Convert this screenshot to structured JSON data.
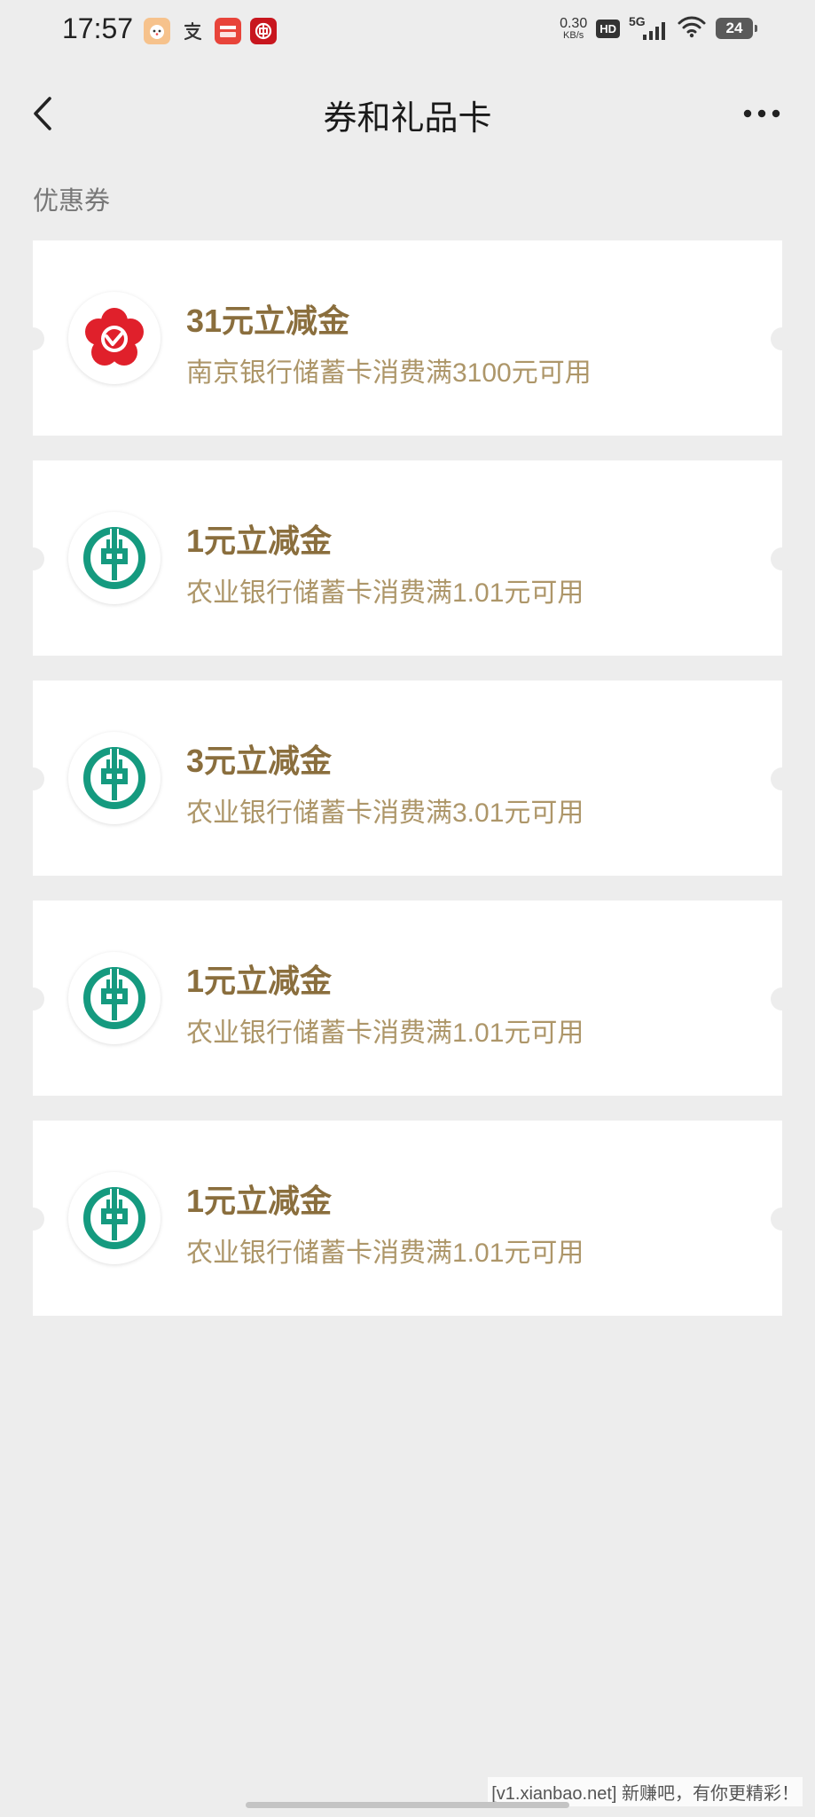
{
  "status_bar": {
    "time": "17:57",
    "net_speed_value": "0.30",
    "net_speed_unit": "KB/s",
    "hd_label": "HD",
    "network_label": "5G",
    "battery": "24",
    "app_icons": [
      "pet-app-icon",
      "alipay-app-icon",
      "unionpay-app-icon",
      "bank-of-china-app-icon"
    ]
  },
  "nav": {
    "title": "券和礼品卡"
  },
  "section": {
    "title": "优惠券"
  },
  "coupons": [
    {
      "bank": "nanjing-bank",
      "title": "31元立减金",
      "desc": "南京银行储蓄卡消费满3100元可用"
    },
    {
      "bank": "agricultural-bank",
      "title": "1元立减金",
      "desc": "农业银行储蓄卡消费满1.01元可用"
    },
    {
      "bank": "agricultural-bank",
      "title": "3元立减金",
      "desc": "农业银行储蓄卡消费满3.01元可用"
    },
    {
      "bank": "agricultural-bank",
      "title": "1元立减金",
      "desc": "农业银行储蓄卡消费满1.01元可用"
    },
    {
      "bank": "agricultural-bank",
      "title": "1元立减金",
      "desc": "农业银行储蓄卡消费满1.01元可用"
    }
  ],
  "watermark": "[v1.xianbao.net] 新赚吧，有你更精彩！",
  "colors": {
    "background": "#ededed",
    "card": "#ffffff",
    "coupon_title": "#8a6e3d",
    "coupon_desc": "#ad9669",
    "abc_green": "#159a7f",
    "nanjing_red": "#e0202b"
  }
}
